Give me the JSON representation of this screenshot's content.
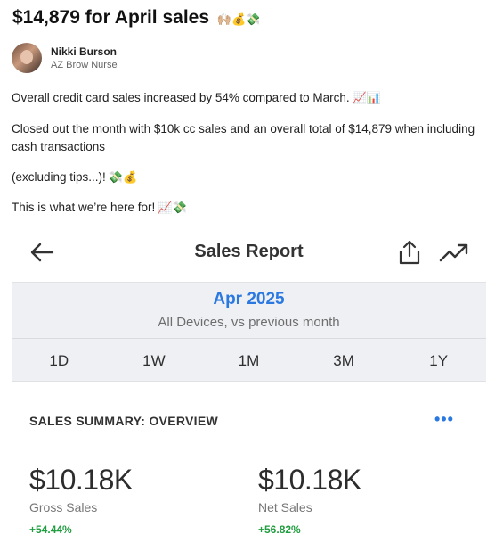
{
  "post": {
    "title": "$14,879 for April sales",
    "title_emoji": "🙌🏼💰💸",
    "author_name": "Nikki Burson",
    "author_role": "AZ Brow Nurse",
    "p1": "Overall credit card sales increased by 54% compared to March.",
    "p1_emoji": "📈📊",
    "p2": "Closed out the month with $10k cc sales and an overall total of $14,879 when including cash transactions",
    "p3": "(excluding tips...)!",
    "p3_emoji": "💸💰",
    "p4": "This is what we’re here for!",
    "p4_emoji": "📈💸"
  },
  "report": {
    "title": "Sales Report",
    "icons": [
      "back-arrow-icon",
      "share-icon",
      "trend-icon"
    ],
    "month": "Apr 2025",
    "subtitle": "All Devices, vs previous month",
    "tabs": [
      "1D",
      "1W",
      "1M",
      "3M",
      "1Y"
    ],
    "summary_label": "SALES SUMMARY: OVERVIEW",
    "more_label": "•••",
    "gross": {
      "value": "$10.18K",
      "label": "Gross Sales",
      "change": "+54.44%"
    },
    "net": {
      "value": "$10.18K",
      "label": "Net Sales",
      "change": "+56.82%"
    }
  },
  "colors": {
    "accent": "#2a78e0",
    "positive": "#1f9d3f",
    "panel": "#eef0f3"
  }
}
